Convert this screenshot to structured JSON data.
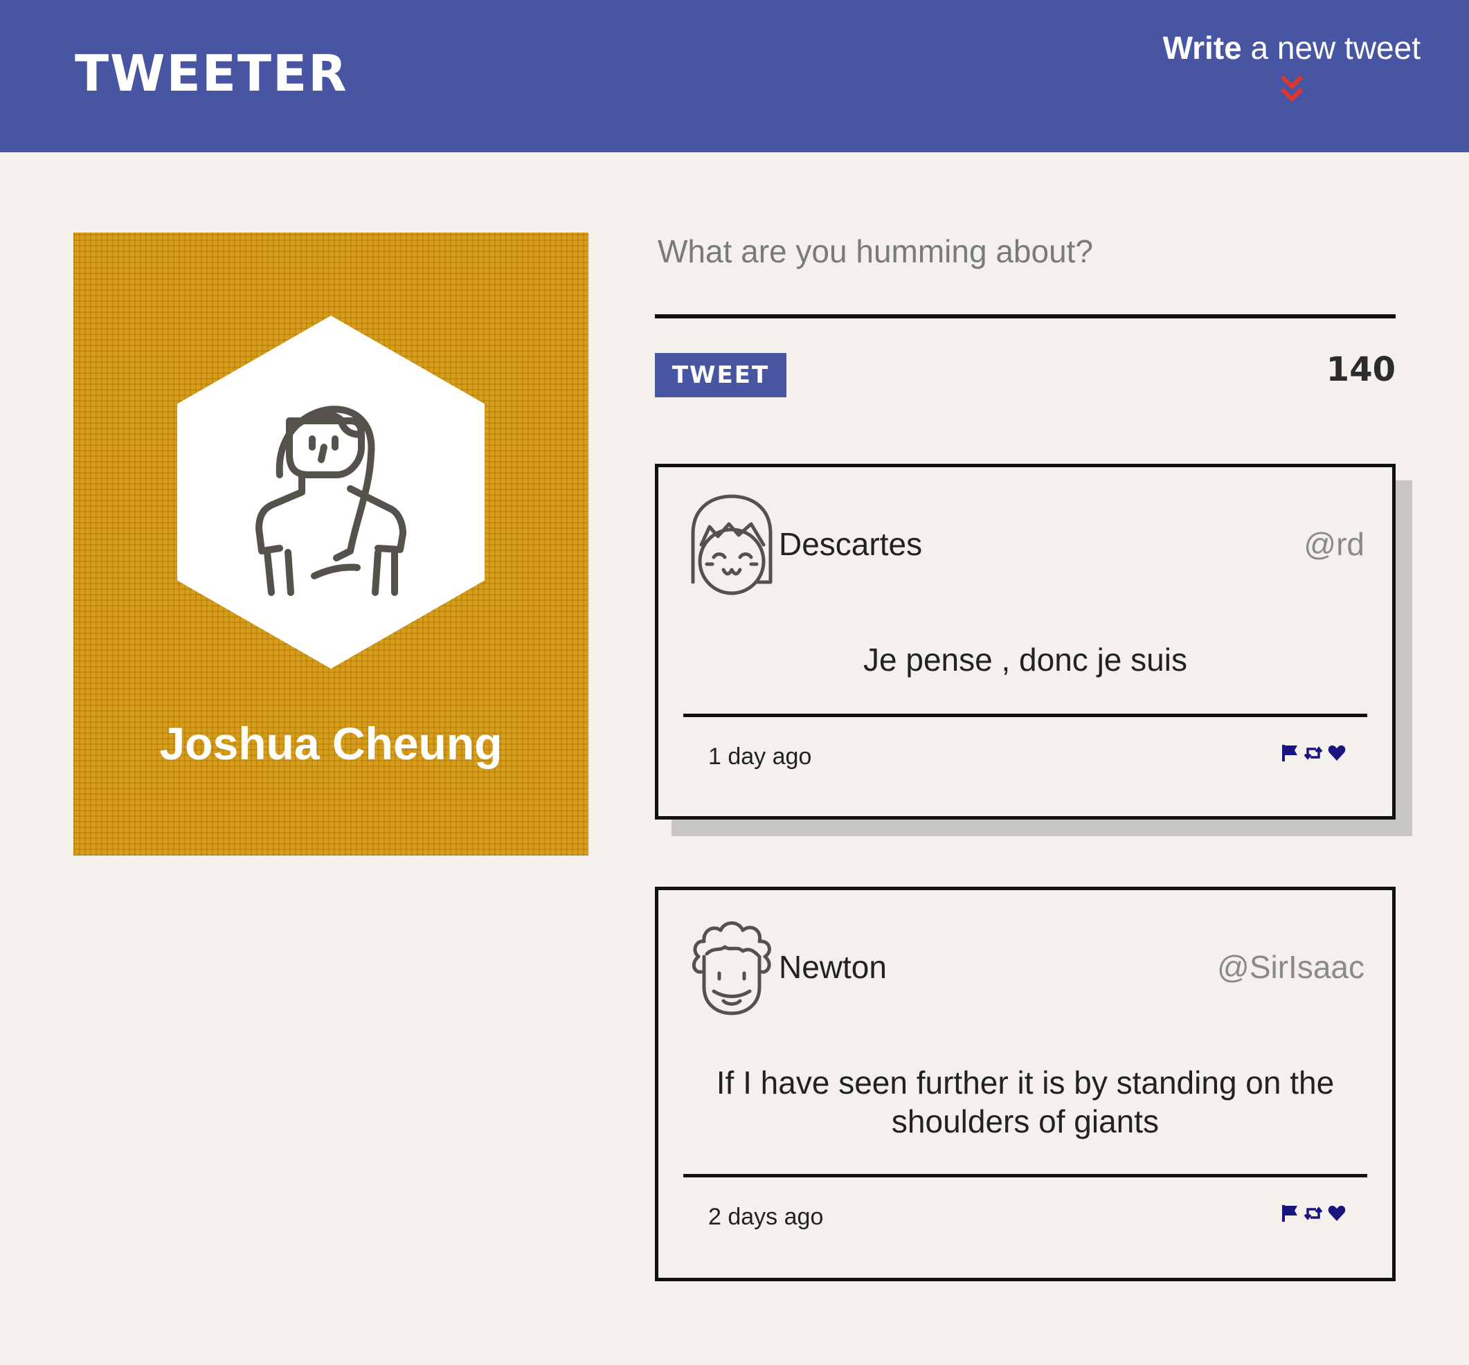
{
  "nav": {
    "brand": "TWEETER",
    "compose_bold": "Write",
    "compose_rest": " a new tweet",
    "compose_icon": "double-chevron-down-icon",
    "accent_color": "#e2352b"
  },
  "colors": {
    "nav_bg": "#4855a2",
    "page_bg": "#f4f1ec",
    "profile_bg": "#d99d18",
    "icon_color": "#1a1480"
  },
  "profile": {
    "name": "Joshua Cheung",
    "avatar_icon": "woman-avatar-icon"
  },
  "composer": {
    "placeholder": "What are you humming about?",
    "value": "",
    "submit_label": "TWEET",
    "char_count": "140"
  },
  "tweets": [
    {
      "author": "Descartes",
      "handle": "@rd",
      "content": "Je pense , donc je suis",
      "time": "1 day ago",
      "avatar_icon": "girl-avatar-icon",
      "actions": [
        "flag-icon",
        "retweet-icon",
        "heart-icon"
      ]
    },
    {
      "author": "Newton",
      "handle": "@SirIsaac",
      "content": "If I have seen further it is by standing on the shoulders of giants",
      "time": "2 days ago",
      "avatar_icon": "curly-hair-avatar-icon",
      "actions": [
        "flag-icon",
        "retweet-icon",
        "heart-icon"
      ]
    }
  ]
}
